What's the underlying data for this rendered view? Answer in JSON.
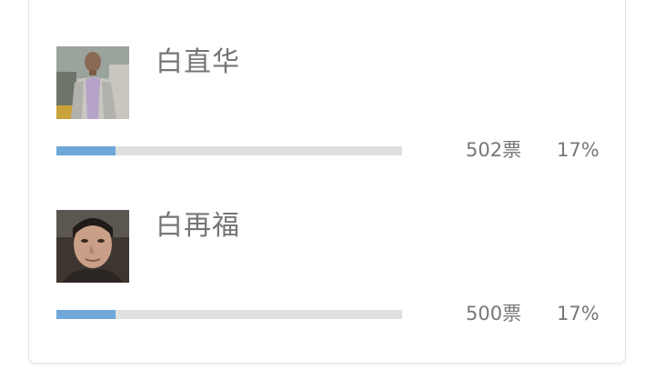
{
  "colors": {
    "bar_fill": "#6fa7d9",
    "bar_track": "#e0e0e0",
    "text": "#777777",
    "card_border": "#e3e3e3"
  },
  "candidates": [
    {
      "name": "白直华",
      "votes": "502票",
      "percent": "17%",
      "progress_fraction": 0.17
    },
    {
      "name": "白再福",
      "votes": "500票",
      "percent": "17%",
      "progress_fraction": 0.17
    }
  ]
}
